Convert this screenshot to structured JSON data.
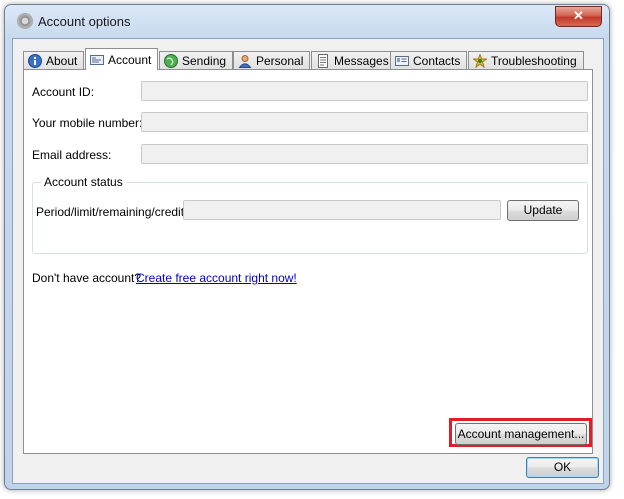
{
  "window": {
    "title": "Account options",
    "close_glyph": "✕"
  },
  "tabs": [
    {
      "label": "About",
      "icon": "info-icon"
    },
    {
      "label": "Account",
      "icon": "account-card-icon",
      "active": true
    },
    {
      "label": "Sending",
      "icon": "globe-icon"
    },
    {
      "label": "Personal",
      "icon": "person-icon"
    },
    {
      "label": "Messages",
      "icon": "messages-icon"
    },
    {
      "label": "Contacts",
      "icon": "contacts-icon"
    },
    {
      "label": "Troubleshooting",
      "icon": "troubleshooting-icon"
    }
  ],
  "account": {
    "account_id_label": "Account ID:",
    "account_id_value": "",
    "mobile_label": "Your mobile number:",
    "mobile_value": "",
    "email_label": "Email address:",
    "email_value": "",
    "status_group_title": "Account status",
    "status_label": "Period/limit/remaining/credit:",
    "status_value": "",
    "update_button": "Update",
    "no_account_text": "Don't have account?",
    "create_link": "Create free account right now!"
  },
  "buttons": {
    "account_management": "Account management...",
    "ok": "OK"
  },
  "colors": {
    "highlight": "#e01e2a",
    "link": "#0000cc"
  }
}
